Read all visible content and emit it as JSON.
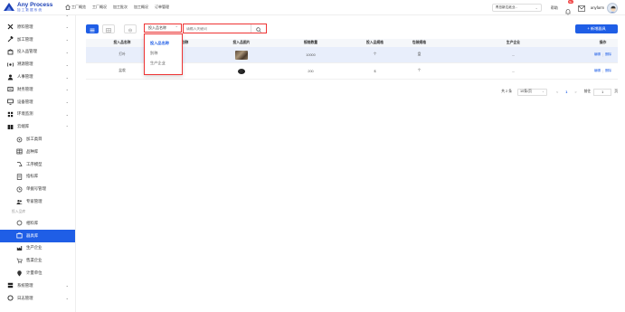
{
  "header": {
    "logo_title": "Any Process",
    "logo_subtitle": "加工数据系统",
    "nav": [
      {
        "label": "工厂概览",
        "icon": "home-icon"
      },
      {
        "label": "工厂概况"
      },
      {
        "label": "加工批次"
      },
      {
        "label": "加工概况"
      },
      {
        "label": "订单管理"
      }
    ],
    "factory_select": "青岛新达纸业...",
    "help_label": "帮助",
    "notification_count": "9+",
    "user_name": "anyfarm"
  },
  "sidebar": {
    "items": [
      {
        "label": "",
        "icon": "partial-icon",
        "arrow": "chevron-down"
      },
      {
        "label": "原料管理",
        "icon": "tools-cross-icon",
        "arrow": "chevron-down"
      },
      {
        "label": "加工管理",
        "icon": "hammer-icon",
        "arrow": "chevron-down"
      },
      {
        "label": "投入品管理",
        "icon": "box-icon",
        "arrow": "chevron-down"
      },
      {
        "label": "溯源管理",
        "icon": "trace-icon",
        "arrow": "chevron-down"
      },
      {
        "label": "人事管理",
        "icon": "person-icon",
        "arrow": "chevron-down"
      },
      {
        "label": "财务管理",
        "icon": "finance-icon",
        "arrow": "chevron-down"
      },
      {
        "label": "设备管理",
        "icon": "monitor-icon",
        "arrow": "chevron-down"
      },
      {
        "label": "环境监测",
        "icon": "grid-icon",
        "arrow": "chevron-down"
      },
      {
        "label": "云端库",
        "icon": "book-icon",
        "arrow": "chevron-up"
      }
    ],
    "subitems_a": [
      {
        "label": "加工类目",
        "icon": "category-icon"
      },
      {
        "label": "品种库",
        "icon": "table-icon"
      },
      {
        "label": "工序模型",
        "icon": "flow-icon"
      },
      {
        "label": "指标库",
        "icon": "doc-icon"
      },
      {
        "label": "单据号管理",
        "icon": "clock-icon"
      },
      {
        "label": "专家管理",
        "icon": "people-icon"
      }
    ],
    "group_label": "投入品库",
    "subitems_b": [
      {
        "label": "相料库",
        "icon": "circle-icon"
      },
      {
        "label": "器具库",
        "icon": "tool-icon",
        "active": true
      },
      {
        "label": "生产企业",
        "icon": "factory-icon"
      },
      {
        "label": "售渠企业",
        "icon": "cart-icon"
      },
      {
        "label": "计量单位",
        "icon": "pin-icon"
      }
    ],
    "bottom": [
      {
        "label": "系统管理",
        "icon": "server-icon",
        "arrow": "chevron-down"
      },
      {
        "label": "日志管理",
        "icon": "log-icon",
        "arrow": "chevron-down"
      }
    ]
  },
  "toolbar": {
    "field_select_value": "投入品名称",
    "search_placeholder": "请输入关键词",
    "add_button": "+ 新增器具"
  },
  "dropdown": {
    "options": [
      "投入品名称",
      "别称",
      "生产企业"
    ],
    "selected_index": 0
  },
  "table": {
    "columns": [
      "投入品名称",
      "别称",
      "投入品图片",
      "规格数量",
      "投入品规格",
      "包装规格",
      "生产企业",
      "操作"
    ],
    "rows": [
      {
        "name": "打叶",
        "alias": "",
        "image": "photo",
        "qty": "10000",
        "spec": "个",
        "pack": "盘",
        "company": "--",
        "ops": [
          "编辑",
          "删除"
        ],
        "highlight": true
      },
      {
        "name": "盆栽",
        "alias": "",
        "image": "round",
        "qty": "200",
        "spec": "$",
        "pack": "个",
        "company": "--",
        "ops": [
          "编辑",
          "删除"
        ],
        "highlight": false
      }
    ]
  },
  "pagination": {
    "total": "共 2 条",
    "page_size": "10条/页",
    "prev": "<",
    "current": "1",
    "next": ">",
    "goto_label": "前往",
    "goto_value": "1",
    "page_suffix": "页"
  },
  "colors": {
    "accent": "#1f5ee6",
    "highlight_border": "#e33333"
  }
}
